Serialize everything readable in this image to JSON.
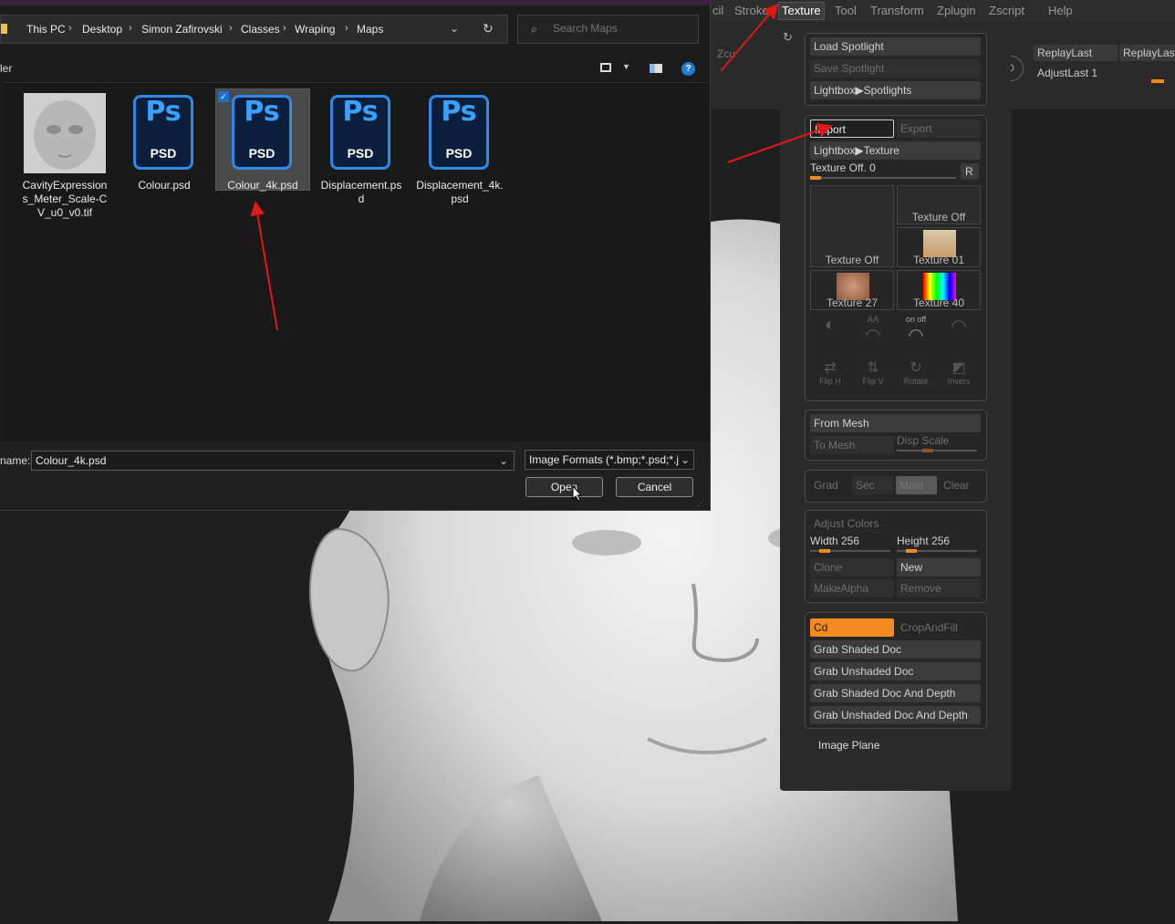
{
  "dialog": {
    "breadcrumb": [
      "This PC",
      "Desktop",
      "Simon Zafirovski",
      "Classes",
      "Wraping",
      "Maps"
    ],
    "search_placeholder": "Search Maps",
    "left_cut_label": "ler",
    "files": [
      {
        "name": "CavityExpressions_Meter_Scale-CV_u0_v0.tif",
        "lines": [
          "CavityExpression",
          "s_Meter_Scale-C",
          "V_u0_v0.tif"
        ],
        "icon": "image-thumbnail-icon"
      },
      {
        "name": "Colour.psd",
        "lines": [
          "Colour.psd"
        ],
        "icon": "psd-file-icon"
      },
      {
        "name": "Colour_4k.psd",
        "lines": [
          "Colour_4k.psd"
        ],
        "icon": "psd-file-icon",
        "selected": true
      },
      {
        "name": "Displacement.psd",
        "lines": [
          "Displacement.ps",
          "d"
        ],
        "icon": "psd-file-icon"
      },
      {
        "name": "Displacement_4k.psd",
        "lines": [
          "Displacement_4k.",
          "psd"
        ],
        "icon": "psd-file-icon"
      }
    ],
    "psd_icon_text": {
      "top": "Ps",
      "bottom": "PSD"
    },
    "filename_label": "name:",
    "filename_value": "Colour_4k.psd",
    "filetype_value": "Image Formats (*.bmp;*.psd;*.j",
    "open_label": "Open",
    "cancel_label": "Cancel"
  },
  "zbrush": {
    "menus": [
      "cil",
      "Stroke",
      "Texture",
      "Tool",
      "Transform",
      "Zplugin",
      "Zscript",
      "Help"
    ],
    "active_menu": "Texture",
    "top_right": {
      "replay_last": "ReplayLast",
      "replay_last2": "ReplayLast",
      "adjust_last": "AdjustLast 1",
      "zcut": "Zcu"
    },
    "texture_palette": {
      "load_spotlight": "Load Spotlight",
      "save_spotlight": "Save Spotlight",
      "lightbox_spotlights": "Lightbox▶Spotlights",
      "import": "Import",
      "export": "Export",
      "lightbox_texture": "Lightbox▶Texture",
      "texture_off_slider": "Texture Off. 0",
      "r_button": "R",
      "thumbs": [
        "Texture Off",
        "Texture Off",
        "Texture 01",
        "Texture 27",
        "Texture 40"
      ],
      "icon_row1": [
        "",
        "AA",
        "on off",
        ""
      ],
      "icon_row2": [
        "Flip H",
        "Flip V",
        "Rotate",
        "Invers"
      ],
      "from_mesh": "From Mesh",
      "to_mesh": "To Mesh",
      "disp_scale": "Disp Scale",
      "grad": "Grad",
      "sec": "Sec",
      "main": "Main",
      "clear": "Clear",
      "adjust_colors": "Adjust Colors",
      "width": "Width 256",
      "height": "Height 256",
      "clone": "Clone",
      "new": "New",
      "make_alpha": "MakeAlpha",
      "remove": "Remove",
      "cd": "Cd",
      "crop_and_fill": "CropAndFill",
      "grab_shaded_doc": "Grab Shaded Doc",
      "grab_unshaded_doc": "Grab Unshaded Doc",
      "grab_shaded_doc_depth": "Grab Shaded Doc And Depth",
      "grab_unshaded_doc_depth": "Grab Unshaded Doc And Depth",
      "image_plane": "Image Plane"
    }
  },
  "colors": {
    "accent_orange": "#f28a1e",
    "psd_blue": "#2f8ae6",
    "arrow_red": "#e01818"
  }
}
